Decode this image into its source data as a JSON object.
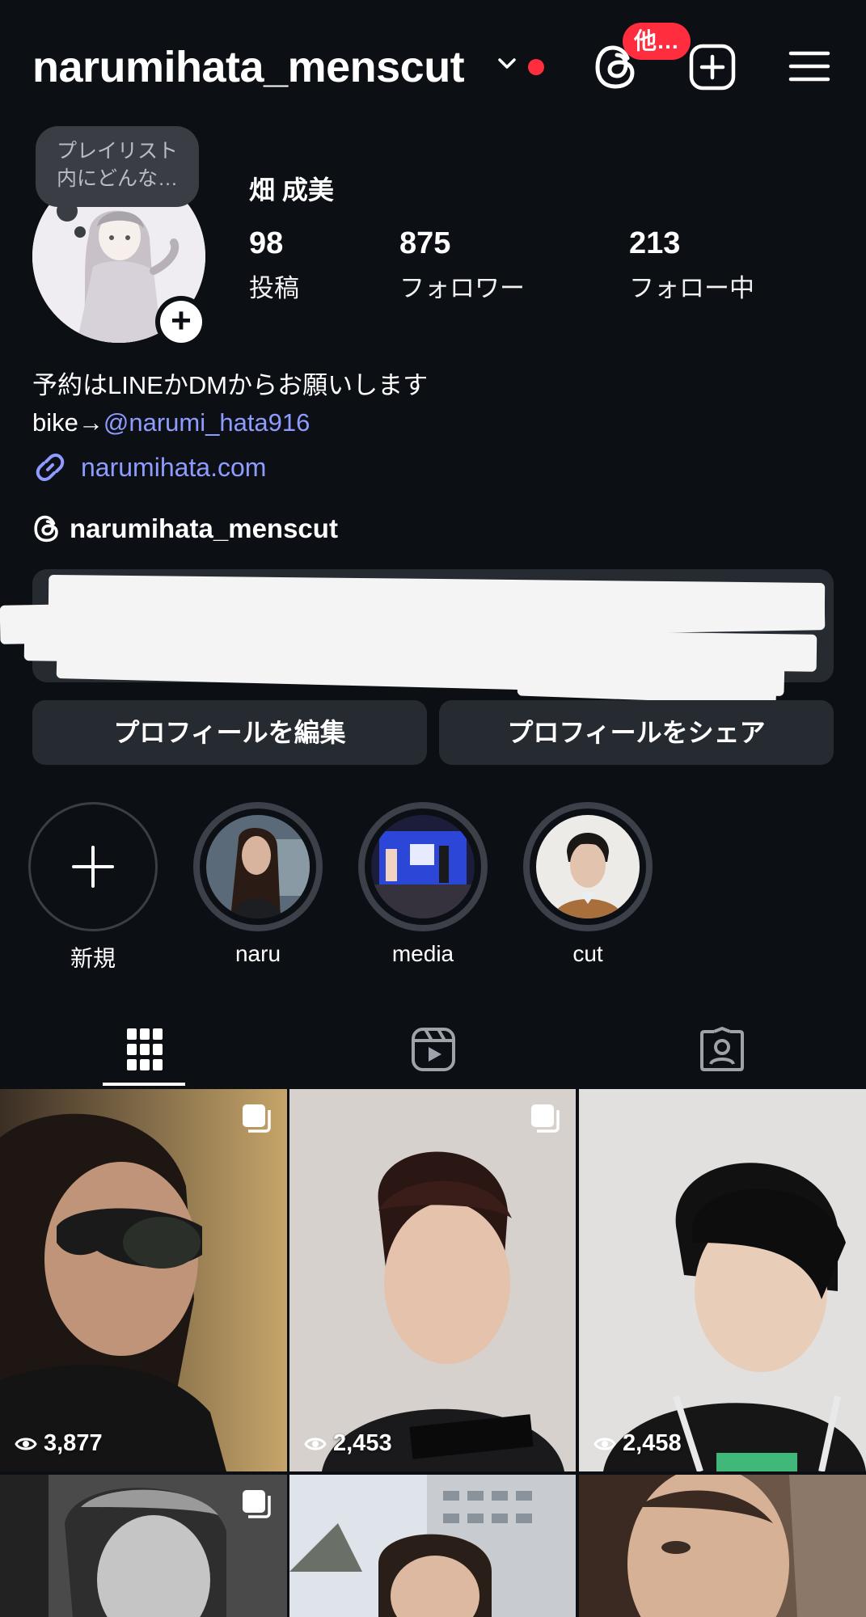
{
  "header": {
    "username": "narumihata_menscut",
    "badge": "他…",
    "colors": {
      "background": "#0c0f14",
      "notification": "#ff2d3d",
      "link": "#8e9bff"
    }
  },
  "profile": {
    "note": "プレイリスト内にどんな…",
    "display_name": "畑 成美",
    "stats": [
      {
        "value": "98",
        "label": "投稿"
      },
      {
        "value": "875",
        "label": "フォロワー"
      },
      {
        "value": "213",
        "label": "フォロー中"
      }
    ],
    "bio_line1": "予約はLINEかDMからお願いします",
    "bio_prefix": "bike→",
    "bio_mention": "@narumi_hata916",
    "link": "narumihata.com",
    "threads_handle": "narumihata_menscut"
  },
  "buttons": {
    "edit": "プロフィールを編集",
    "share": "プロフィールをシェア"
  },
  "highlights": [
    {
      "label": "新規"
    },
    {
      "label": "naru"
    },
    {
      "label": "media"
    },
    {
      "label": "cut"
    }
  ],
  "tabs": [
    "grid-icon",
    "reels-icon",
    "tagged-icon"
  ],
  "posts": [
    {
      "views": "3,877",
      "multi": true
    },
    {
      "views": "2,453",
      "multi": true
    },
    {
      "views": "2,458",
      "multi": false
    },
    {
      "views": "",
      "multi": true
    },
    {
      "views": "",
      "multi": false
    },
    {
      "views": "",
      "multi": false
    }
  ]
}
